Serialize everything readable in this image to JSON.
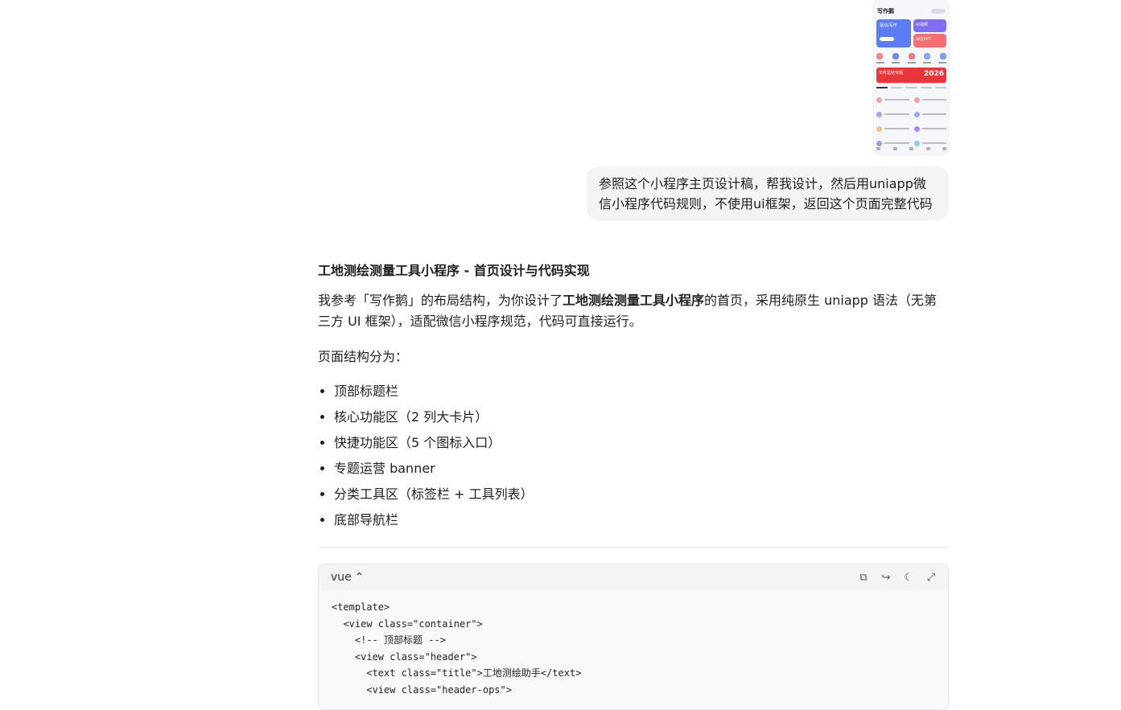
{
  "thumbnail": {
    "app_title": "写作鹅",
    "card_a": "驱动/写作",
    "card_b": "AI视频",
    "card_c": "AI生PPT",
    "banner_text": "年终总结专题",
    "banner_year": "2026"
  },
  "user_message": "参照这个小程序主页设计稿，帮我设计，然后用uniapp微信小程序代码规则，不使用ui框架，返回这个页面完整代码",
  "answer": {
    "title": "工地测绘测量工具小程序 - 首页设计与代码实现",
    "intro_before": "我参考「写作鹅」的布局结构，为你设计了",
    "intro_bold": "工地测绘测量工具小程序",
    "intro_after": "的首页，采用纯原生 uniapp 语法（无第三方 UI 框架），适配微信小程序规范，代码可直接运行。",
    "structure_label": "页面结构分为：",
    "structure_items": [
      "顶部标题栏",
      "核心功能区（2 列大卡片）",
      "快捷功能区（5 个图标入口）",
      "专题运营 banner",
      "分类工具区（标签栏 + 工具列表）",
      "底部导航栏"
    ]
  },
  "code_block": {
    "language": "vue",
    "lines": [
      "<template>",
      "  <view class=\"container\">",
      "    <!-- 顶部标题 -->",
      "    <view class=\"header\">",
      "      <text class=\"title\">工地测绘助手</text>",
      "      <view class=\"header-ops\">"
    ]
  },
  "colors": {
    "bubble_bg": "#f3f4f6",
    "code_bg": "#f8f9fb",
    "thumb_blue": "#5b7cf5",
    "thumb_purple": "#7e6cf2",
    "thumb_red": "#e8363a"
  }
}
